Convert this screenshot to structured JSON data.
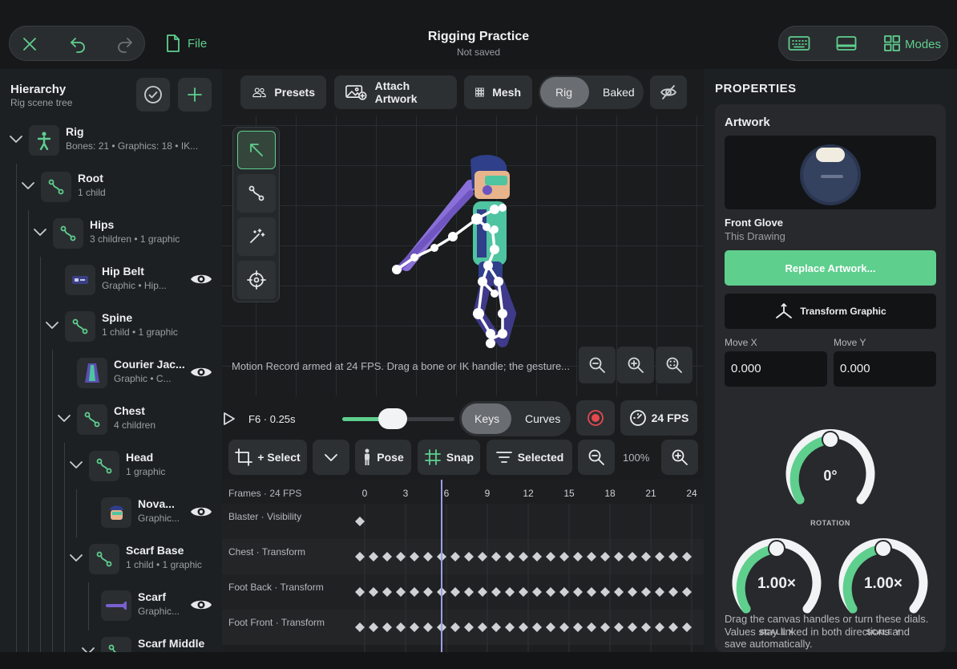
{
  "header": {
    "title": "Rigging Practice",
    "subtitle": "Not saved",
    "file_label": "File",
    "modes_label": "Modes"
  },
  "hierarchy": {
    "title": "Hierarchy",
    "subtitle": "Rig scene tree",
    "rows": [
      {
        "name": "Rig",
        "sub": "Bones: 21  •  Graphics: 18  •  IK..."
      },
      {
        "name": "Root",
        "sub": "1 child"
      },
      {
        "name": "Hips",
        "sub": "3 children  •  1 graphic"
      },
      {
        "name": "Hip Belt",
        "sub": "Graphic  •  Hip..."
      },
      {
        "name": "Spine",
        "sub": "1 child  •  1 graphic"
      },
      {
        "name": "Courier Jac...",
        "sub": "Graphic  •  C..."
      },
      {
        "name": "Chest",
        "sub": "4 children"
      },
      {
        "name": "Head",
        "sub": "1 graphic"
      },
      {
        "name": "Nova...",
        "sub": "Graphic..."
      },
      {
        "name": "Scarf Base",
        "sub": "1 child  •  1 graphic"
      },
      {
        "name": "Scarf",
        "sub": "Graphic..."
      },
      {
        "name": "Scarf Middle",
        "sub": ""
      }
    ]
  },
  "toolbar": {
    "presets": "Presets",
    "attach": "Attach Artwork",
    "mesh": "Mesh",
    "rig": "Rig",
    "baked": "Baked"
  },
  "canvas": {
    "status": "Motion Record armed at 24 FPS. Drag a bone or IK handle; the gesture..."
  },
  "timeline": {
    "frame_label": "F6 · 0.25s",
    "scrub_fraction": 0.25,
    "keys": "Keys",
    "curves": "Curves",
    "fps": "24 FPS",
    "select": "+ Select",
    "pose": "Pose",
    "snap": "Snap",
    "selected": "Selected",
    "zoom": "100%",
    "frames_label": "Frames · 24 FPS",
    "ticks": [
      "0",
      "3",
      "6",
      "9",
      "12",
      "15",
      "18",
      "21",
      "24"
    ],
    "current_frame": 6,
    "tracks": [
      {
        "name": "Blaster · Visibility",
        "keyframes": [
          0
        ]
      },
      {
        "name": "Chest · Transform",
        "keyframes": [
          0,
          1,
          2,
          3,
          4,
          5,
          6,
          7,
          8,
          9,
          10,
          11,
          12,
          13,
          14,
          15,
          16,
          17,
          18,
          19,
          20,
          21,
          22,
          23,
          24
        ]
      },
      {
        "name": "Foot Back · Transform",
        "keyframes": [
          0,
          1,
          2,
          3,
          4,
          5,
          6,
          7,
          8,
          9,
          10,
          11,
          12,
          13,
          14,
          15,
          16,
          17,
          18,
          19,
          20,
          21,
          22,
          23,
          24
        ]
      },
      {
        "name": "Foot Front · Transform",
        "keyframes": [
          0,
          1,
          2,
          3,
          4,
          5,
          6,
          7,
          8,
          9,
          10,
          11,
          12,
          13,
          14,
          15,
          16,
          17,
          18,
          19,
          20,
          21,
          22,
          23,
          24
        ]
      }
    ]
  },
  "properties": {
    "title": "PROPERTIES",
    "artwork_title": "Artwork",
    "art_name": "Front Glove",
    "art_src": "This Drawing",
    "replace": "Replace Artwork...",
    "transform": "Transform Graphic",
    "move_x_label": "Move X",
    "move_x": "0.000",
    "move_y_label": "Move Y",
    "move_y": "0.000",
    "rotation": "0°",
    "rotation_label": "ROTATION",
    "scale_x": "1.00×",
    "scale_x_label": "SCALE X",
    "scale_y": "1.00×",
    "scale_y_label": "SCALE Y",
    "help": "Drag the canvas handles or turn these dials. Values stay linked in both directions and save automatically."
  },
  "colors": {
    "accent": "#5fcf8e",
    "record": "#e5484d"
  }
}
